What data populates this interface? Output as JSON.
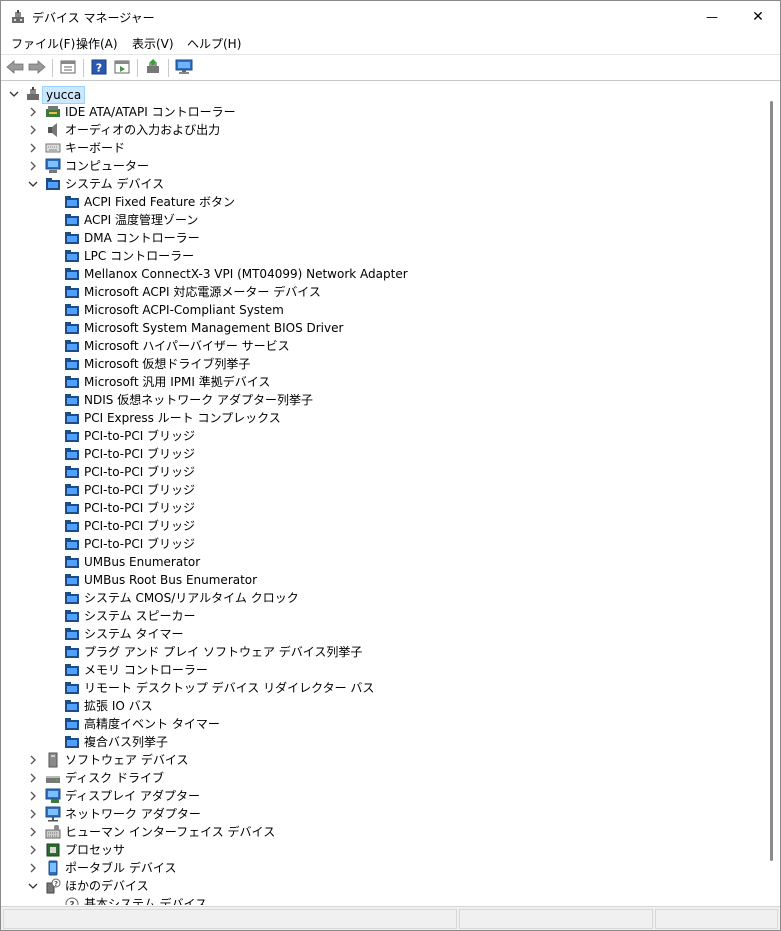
{
  "window": {
    "title": "デバイス マネージャー",
    "minimize_glyph": "—",
    "maximize_glyph": "☐",
    "close_glyph": "✕"
  },
  "menu": [
    "ファイル(F)",
    "操作(A)",
    "表示(V)",
    "ヘルプ(H)"
  ],
  "toolbar": {
    "buttons": [
      "back-arrow-icon",
      "forward-arrow-icon",
      "properties-icon",
      "help-icon",
      "show-hide-pane-icon",
      "update-driver-icon",
      "monitor-icon"
    ]
  },
  "tree": {
    "root": "yucca",
    "items": [
      {
        "label": "IDE ATA/ATAPI コントローラー",
        "icon": "ide-controller-icon",
        "expanded": false
      },
      {
        "label": "オーディオの入力および出力",
        "icon": "speaker-icon",
        "expanded": false
      },
      {
        "label": "キーボード",
        "icon": "keyboard-icon",
        "expanded": false
      },
      {
        "label": "コンピューター",
        "icon": "computer-icon",
        "expanded": false
      },
      {
        "label": "システム デバイス",
        "icon": "system-folder-icon",
        "expanded": true,
        "children": [
          "ACPI Fixed Feature ボタン",
          "ACPI 温度管理ゾーン",
          "DMA コントローラー",
          "LPC コントローラー",
          "Mellanox ConnectX-3 VPI (MT04099) Network Adapter",
          "Microsoft ACPI 対応電源メーター デバイス",
          "Microsoft ACPI-Compliant System",
          "Microsoft System Management BIOS Driver",
          "Microsoft ハイパーバイザー サービス",
          "Microsoft 仮想ドライブ列挙子",
          "Microsoft 汎用 IPMI 準拠デバイス",
          "NDIS 仮想ネットワーク アダプター列挙子",
          "PCI Express ルート コンプレックス",
          "PCI-to-PCI ブリッジ",
          "PCI-to-PCI ブリッジ",
          "PCI-to-PCI ブリッジ",
          "PCI-to-PCI ブリッジ",
          "PCI-to-PCI ブリッジ",
          "PCI-to-PCI ブリッジ",
          "PCI-to-PCI ブリッジ",
          "UMBus Enumerator",
          "UMBus Root Bus Enumerator",
          "システム CMOS/リアルタイム クロック",
          "システム スピーカー",
          "システム タイマー",
          "プラグ アンド プレイ ソフトウェア デバイス列挙子",
          "メモリ コントローラー",
          "リモート デスクトップ デバイス リダイレクター バス",
          "拡張 IO バス",
          "高精度イベント タイマー",
          "複合バス列挙子"
        ]
      },
      {
        "label": "ソフトウェア デバイス",
        "icon": "software-device-icon",
        "expanded": false
      },
      {
        "label": "ディスク ドライブ",
        "icon": "disk-drive-icon",
        "expanded": false
      },
      {
        "label": "ディスプレイ アダプター",
        "icon": "display-adapter-icon",
        "expanded": false
      },
      {
        "label": "ネットワーク アダプター",
        "icon": "network-adapter-icon",
        "expanded": false
      },
      {
        "label": "ヒューマン インターフェイス デバイス",
        "icon": "hid-icon",
        "expanded": false
      },
      {
        "label": "プロセッサ",
        "icon": "processor-icon",
        "expanded": false
      },
      {
        "label": "ポータブル デバイス",
        "icon": "portable-device-icon",
        "expanded": false
      },
      {
        "label": "ほかのデバイス",
        "icon": "unknown-device-icon",
        "expanded": true,
        "children": [
          "基本システム デバイス"
        ]
      }
    ]
  }
}
